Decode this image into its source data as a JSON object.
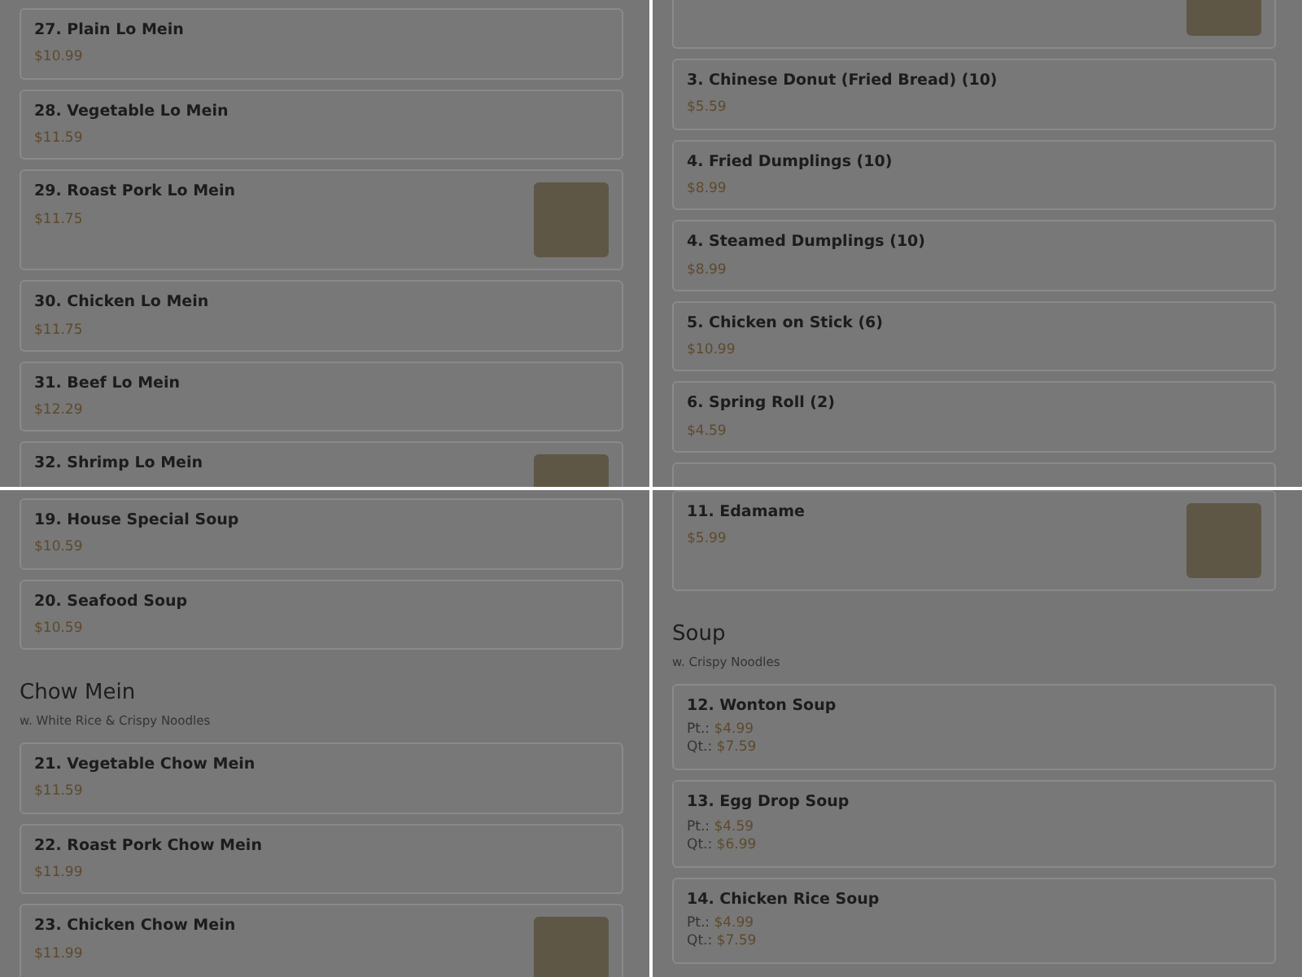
{
  "panels": [
    {
      "blocks": [
        {
          "kind": "item",
          "name": "27. Plain Lo Mein",
          "price": "$10.99"
        },
        {
          "kind": "item",
          "name": "28. Vegetable Lo Mein",
          "price": "$11.59"
        },
        {
          "kind": "item",
          "name": "29. Roast Pork Lo Mein",
          "price": "$11.75",
          "photo": true
        },
        {
          "kind": "item",
          "name": "30. Chicken Lo Mein",
          "price": "$11.75"
        },
        {
          "kind": "item",
          "name": "31. Beef Lo Mein",
          "price": "$12.29"
        },
        {
          "kind": "item",
          "name": "32. Shrimp Lo Mein",
          "photo": true
        }
      ]
    },
    {
      "blocks": [
        {
          "kind": "cut",
          "photo": true
        },
        {
          "kind": "item",
          "name": "3. Chinese Donut (Fried Bread) (10)",
          "price": "$5.59"
        },
        {
          "kind": "item",
          "name": "4. Fried Dumplings (10)",
          "price": "$8.99"
        },
        {
          "kind": "item",
          "name": "4. Steamed Dumplings (10)",
          "price": "$8.99"
        },
        {
          "kind": "item",
          "name": "5. Chicken on Stick (6)",
          "price": "$10.99"
        },
        {
          "kind": "item",
          "name": "6. Spring Roll (2)",
          "price": "$4.59"
        },
        {
          "kind": "item"
        }
      ]
    },
    {
      "blocks": [
        {
          "kind": "item",
          "name": "19. House Special Soup",
          "price": "$10.59"
        },
        {
          "kind": "item",
          "name": "20. Seafood Soup",
          "price": "$10.59"
        },
        {
          "kind": "heading",
          "title": "Chow Mein",
          "subtitle": "w. White Rice & Crispy Noodles"
        },
        {
          "kind": "item",
          "name": "21. Vegetable Chow Mein",
          "price": "$11.59"
        },
        {
          "kind": "item",
          "name": "22. Roast Pork Chow Mein",
          "price": "$11.99"
        },
        {
          "kind": "item",
          "name": "23. Chicken Chow Mein",
          "price": "$11.99",
          "photo": true
        }
      ]
    },
    {
      "blocks": [
        {
          "kind": "item",
          "name": "11. Edamame",
          "price": "$5.99",
          "photo": true
        },
        {
          "kind": "heading",
          "title": "Soup",
          "subtitle": "w. Crispy Noodles"
        },
        {
          "kind": "item",
          "name": "12. Wonton Soup",
          "prices": [
            {
              "label": "Pt.:",
              "value": "$4.99"
            },
            {
              "label": "Qt.:",
              "value": "$7.59"
            }
          ]
        },
        {
          "kind": "item",
          "name": "13. Egg Drop Soup",
          "prices": [
            {
              "label": "Pt.:",
              "value": "$4.59"
            },
            {
              "label": "Qt.:",
              "value": "$6.99"
            }
          ]
        },
        {
          "kind": "item",
          "name": "14. Chicken Rice Soup",
          "prices": [
            {
              "label": "Pt.:",
              "value": "$4.99"
            },
            {
              "label": "Qt.:",
              "value": "$7.59"
            }
          ]
        }
      ]
    }
  ]
}
